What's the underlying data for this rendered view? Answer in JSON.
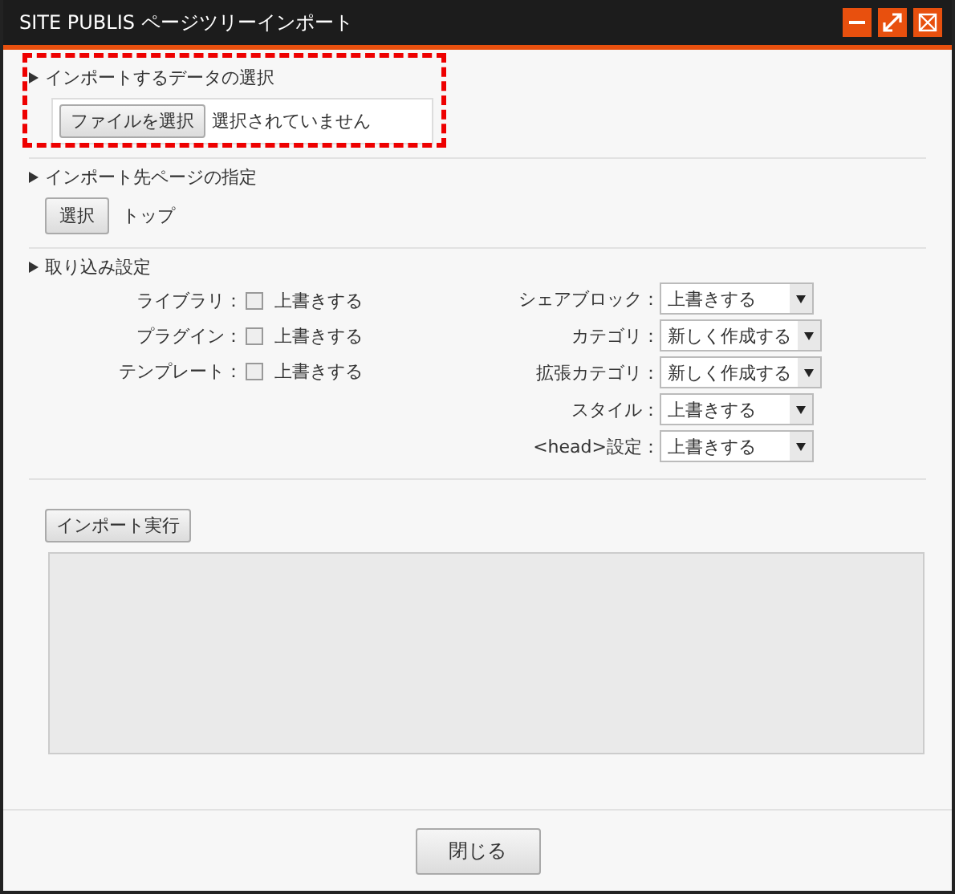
{
  "window": {
    "title": "SITE PUBLIS ページツリーインポート"
  },
  "file_section": {
    "heading": "インポートするデータの選択",
    "button": "ファイルを選択",
    "status": "選択されていません"
  },
  "target_section": {
    "heading": "インポート先ページの指定",
    "button": "選択",
    "value": "トップ"
  },
  "settings_section": {
    "heading": "取り込み設定",
    "checkbox_options": [
      {
        "label": "ライブラリ：",
        "option": "上書きする",
        "checked": false
      },
      {
        "label": "プラグイン：",
        "option": "上書きする",
        "checked": false
      },
      {
        "label": "テンプレート：",
        "option": "上書きする",
        "checked": false
      }
    ],
    "select_options": [
      {
        "label": "シェアブロック：",
        "value": "上書きする"
      },
      {
        "label": "カテゴリ：",
        "value": "新しく作成する"
      },
      {
        "label": "拡張カテゴリ：",
        "value": "新しく作成する"
      },
      {
        "label": "スタイル：",
        "value": "上書きする"
      },
      {
        "label": "<head>設定：",
        "value": "上書きする"
      }
    ]
  },
  "execute_button": "インポート実行",
  "close_button": "閉じる"
}
